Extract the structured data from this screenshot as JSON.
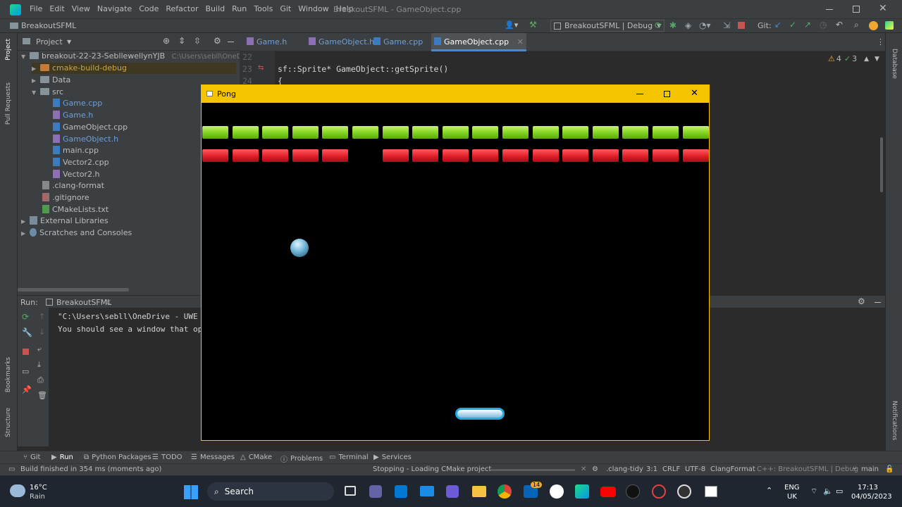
{
  "window": {
    "title": "BreakoutSFML - GameObject.cpp",
    "menu": [
      "File",
      "Edit",
      "View",
      "Navigate",
      "Code",
      "Refactor",
      "Build",
      "Run",
      "Tools",
      "Git",
      "Window",
      "Help"
    ]
  },
  "navbar": {
    "project": "BreakoutSFML",
    "run_config": "BreakoutSFML | Debug",
    "git_label": "Git:"
  },
  "project_panel": {
    "title": "Project",
    "items": [
      {
        "label": "breakout-22-23-SebllewellynYJB",
        "extra": "C:\\Users\\sebll\\OneDrive - UW",
        "type": "root"
      },
      {
        "label": "cmake-build-debug",
        "type": "folder-excluded"
      },
      {
        "label": "Data",
        "type": "folder"
      },
      {
        "label": "src",
        "type": "folder"
      },
      {
        "label": "Game.cpp",
        "type": "cpp"
      },
      {
        "label": "Game.h",
        "type": "h"
      },
      {
        "label": "GameObject.cpp",
        "type": "cpp"
      },
      {
        "label": "GameObject.h",
        "type": "h"
      },
      {
        "label": "main.cpp",
        "type": "cpp"
      },
      {
        "label": "Vector2.cpp",
        "type": "cpp"
      },
      {
        "label": "Vector2.h",
        "type": "h"
      },
      {
        "label": ".clang-format",
        "type": "cfg"
      },
      {
        "label": ".gitignore",
        "type": "cfg"
      },
      {
        "label": "CMakeLists.txt",
        "type": "cmake"
      },
      {
        "label": "External Libraries",
        "type": "lib"
      },
      {
        "label": "Scratches and Consoles",
        "type": "scratch"
      }
    ]
  },
  "tabs": [
    {
      "label": "Game.h",
      "active": false
    },
    {
      "label": "GameObject.h",
      "active": false
    },
    {
      "label": "Game.cpp",
      "active": false
    },
    {
      "label": "GameObject.cpp",
      "active": true
    }
  ],
  "editor": {
    "lines": [
      {
        "num": "22",
        "code": ""
      },
      {
        "num": "23",
        "code": "sf::Sprite* GameObject::getSprite()"
      },
      {
        "num": "24",
        "code": "{"
      }
    ],
    "warnings": "4",
    "checks": "3"
  },
  "left_strip": [
    "Project",
    "Pull Requests",
    "Bookmarks",
    "Structure"
  ],
  "right_strip": [
    "Database",
    "Notifications"
  ],
  "run_panel": {
    "label": "Run:",
    "tab": "BreakoutSFML",
    "output": [
      "\"C:\\Users\\sebll\\OneDrive - UWE",
      "You should see a window that op"
    ]
  },
  "tool_tabs": [
    "Git",
    "Run",
    "Python Packages",
    "TODO",
    "Messages",
    "CMake",
    "Problems",
    "Terminal",
    "Services"
  ],
  "status": {
    "left": "Build finished in 354 ms (moments ago)",
    "middle": "Stopping - Loading CMake project...",
    "tidy": ".clang-tidy",
    "position": "3:1",
    "line_ending": "CRLF",
    "encoding": "UTF-8",
    "formatter": "ClangFormat",
    "context": "C++: BreakoutSFML | Debug",
    "branch": "main"
  },
  "pong": {
    "title": "Pong",
    "green_row_count": 17,
    "red_row_missing": [
      5
    ],
    "colors": {
      "green": "#7fd320",
      "red": "#e01e2a",
      "frame": "#f5c400"
    }
  },
  "taskbar": {
    "weather_temp": "16°C",
    "weather_desc": "Rain",
    "search": "Search",
    "lang": "ENG",
    "region": "UK",
    "time": "17:13",
    "date": "04/05/2023",
    "badge": "14"
  }
}
